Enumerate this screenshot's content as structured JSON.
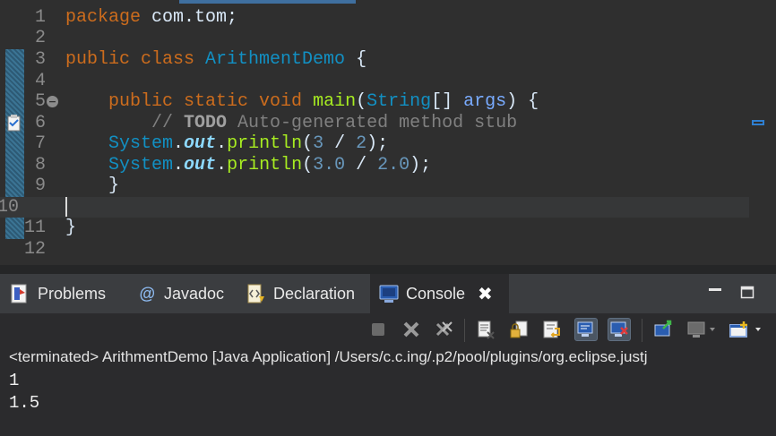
{
  "editor": {
    "lines": [
      {
        "n": "1",
        "tokens": [
          {
            "t": "package ",
            "c": "kw"
          },
          {
            "t": "com.tom;",
            "c": ""
          }
        ]
      },
      {
        "n": "2",
        "tokens": []
      },
      {
        "n": "3",
        "tokens": [
          {
            "t": "public ",
            "c": "kw"
          },
          {
            "t": "class ",
            "c": "kw"
          },
          {
            "t": "ArithmentDemo",
            "c": "ty"
          },
          {
            "t": " {",
            "c": ""
          }
        ]
      },
      {
        "n": "4",
        "tokens": []
      },
      {
        "n": "5",
        "tokens": [
          {
            "t": "    public ",
            "c": "kw"
          },
          {
            "t": "static ",
            "c": "kw"
          },
          {
            "t": "void ",
            "c": "kw"
          },
          {
            "t": "main",
            "c": "fn"
          },
          {
            "t": "(",
            "c": ""
          },
          {
            "t": "String",
            "c": "ty"
          },
          {
            "t": "[] ",
            "c": ""
          },
          {
            "t": "args",
            "c": "params"
          },
          {
            "t": ") {",
            "c": ""
          }
        ]
      },
      {
        "n": "6",
        "tokens": [
          {
            "t": "        // ",
            "c": "cmt"
          },
          {
            "t": "TODO",
            "c": "todo"
          },
          {
            "t": " Auto-generated method stub",
            "c": "cmt"
          }
        ]
      },
      {
        "n": "7",
        "tokens": [
          {
            "t": "    ",
            "c": ""
          },
          {
            "t": "System",
            "c": "ty"
          },
          {
            "t": ".",
            "c": ""
          },
          {
            "t": "out",
            "c": "static-field"
          },
          {
            "t": ".",
            "c": ""
          },
          {
            "t": "println",
            "c": "fn"
          },
          {
            "t": "(",
            "c": ""
          },
          {
            "t": "3",
            "c": "num"
          },
          {
            "t": " / ",
            "c": ""
          },
          {
            "t": "2",
            "c": "num"
          },
          {
            "t": ");",
            "c": ""
          }
        ]
      },
      {
        "n": "8",
        "tokens": [
          {
            "t": "    ",
            "c": ""
          },
          {
            "t": "System",
            "c": "ty"
          },
          {
            "t": ".",
            "c": ""
          },
          {
            "t": "out",
            "c": "static-field"
          },
          {
            "t": ".",
            "c": ""
          },
          {
            "t": "println",
            "c": "fn"
          },
          {
            "t": "(",
            "c": ""
          },
          {
            "t": "3.0",
            "c": "num"
          },
          {
            "t": " / ",
            "c": ""
          },
          {
            "t": "2.0",
            "c": "num"
          },
          {
            "t": ");",
            "c": ""
          }
        ]
      },
      {
        "n": "9",
        "tokens": [
          {
            "t": "    }",
            "c": ""
          }
        ]
      },
      {
        "n": "10",
        "tokens": [],
        "current": true
      },
      {
        "n": "11",
        "tokens": [
          {
            "t": "}",
            "c": ""
          }
        ]
      },
      {
        "n": "12",
        "tokens": []
      }
    ]
  },
  "panel": {
    "tabs": {
      "problems": "Problems",
      "javadoc": "Javadoc",
      "declaration": "Declaration",
      "console": "Console"
    },
    "status": "<terminated> ArithmentDemo [Java Application] /Users/c.c.ing/.p2/pool/plugins/org.eclipse.justj",
    "output": [
      "1",
      "1.5"
    ]
  },
  "colors": {
    "editor_bg": "#2f2f2f",
    "keyword": "#cc6c1d",
    "type": "#1290c3",
    "method": "#a7ec21",
    "number": "#6897bb",
    "comment": "#808080"
  },
  "icons": [
    "fold-collapse-icon",
    "task-marker-icon",
    "problems-icon",
    "javadoc-icon",
    "declaration-icon",
    "console-icon",
    "close-icon",
    "minimize-icon",
    "maximize-icon",
    "terminate-icon",
    "remove-launch-icon",
    "remove-all-icon",
    "clear-console-icon",
    "scroll-lock-icon",
    "word-wrap-icon",
    "show-on-stdout-icon",
    "show-on-stderr-icon",
    "pin-console-icon",
    "display-console-icon",
    "open-console-icon"
  ]
}
